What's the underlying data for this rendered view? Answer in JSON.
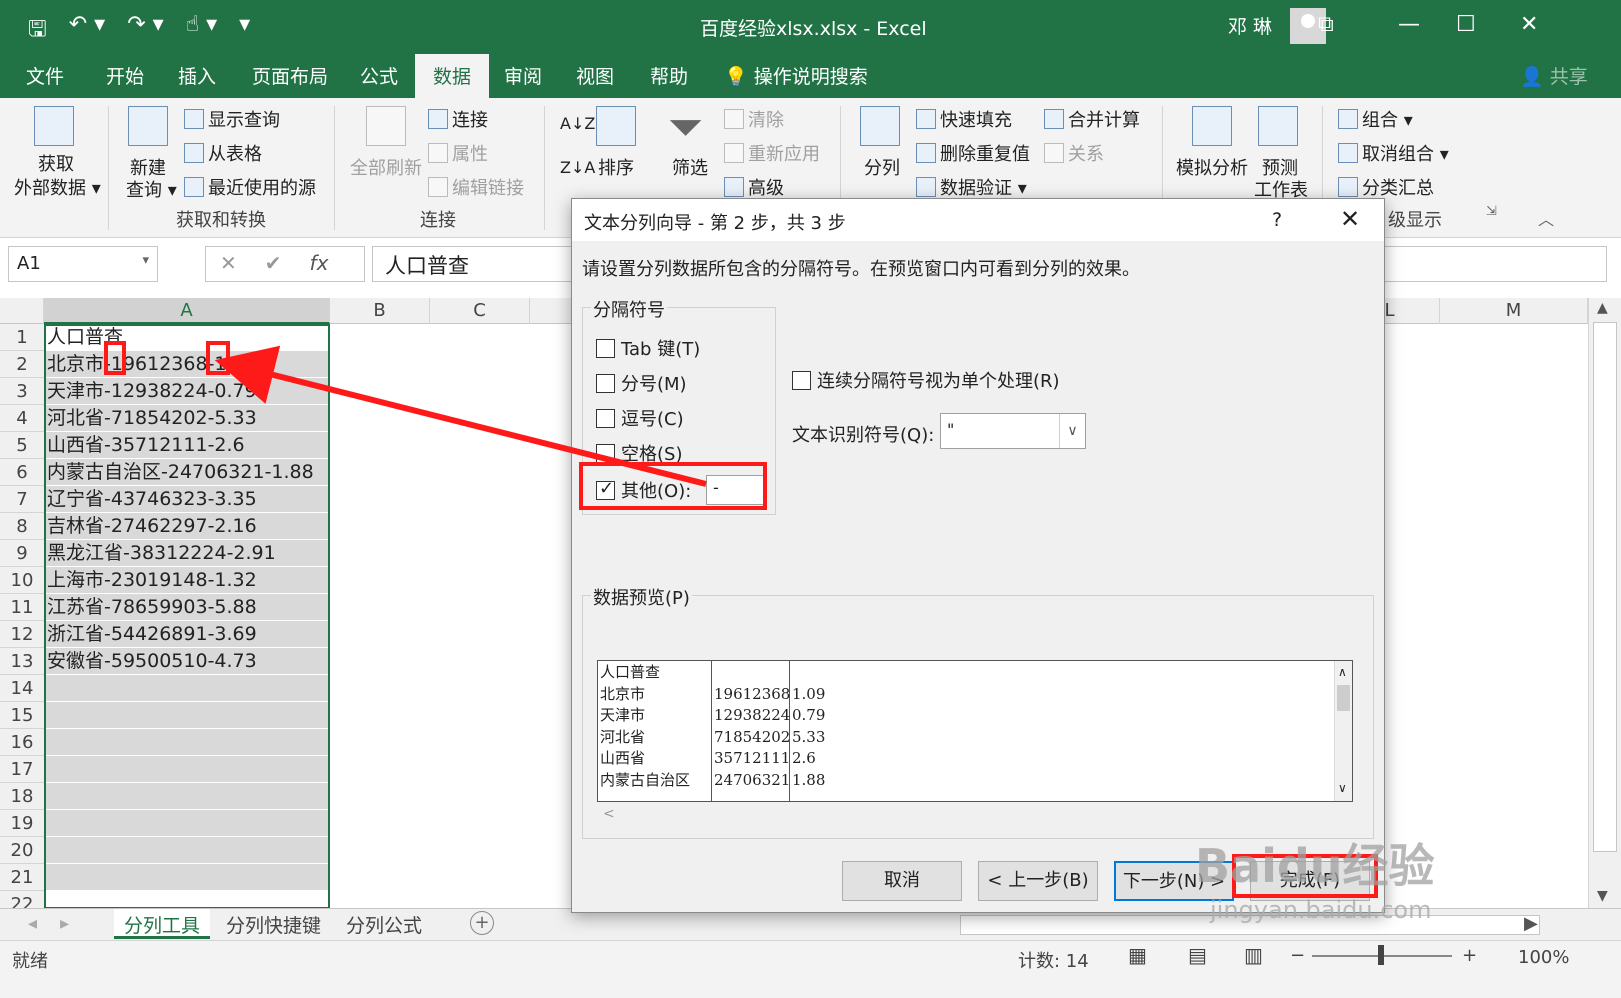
{
  "window": {
    "doc_title": "百度经验xlsx.xlsx  -  Excel",
    "user": "邓 琳",
    "share": "共享"
  },
  "tabs": [
    "文件",
    "开始",
    "插入",
    "页面布局",
    "公式",
    "数据",
    "审阅",
    "视图",
    "帮助",
    "操作说明搜索"
  ],
  "ribbon": {
    "get_data": [
      "获取",
      "外部数据 ▾"
    ],
    "new_query": [
      "新建",
      "查询 ▾"
    ],
    "show_query": "显示查询",
    "from_table": "从表格",
    "recent_sources": "最近使用的源",
    "group_get_transform": "获取和转换",
    "refresh_all": "全部刷新",
    "connections": "连接",
    "properties": "属性",
    "edit_links": "编辑链接",
    "group_connections": "连接",
    "sort": "排序",
    "filter": "筛选",
    "clear": "清除",
    "reapply": "重新应用",
    "advanced": "高级",
    "text_to_columns": "分列",
    "flash_fill": "快速填充",
    "remove_duplicates": "删除重复值",
    "data_validation": "数据验证 ▾",
    "consolidate": "合并计算",
    "relationships": "关系",
    "what_if": "模拟分析",
    "forecast": [
      "预测",
      "工作表"
    ],
    "group": "组合 ▾",
    "ungroup": "取消组合 ▾",
    "subtotal": "分类汇总",
    "group_outline": "级显示"
  },
  "formula_bar": {
    "name_box": "A1",
    "cancel": "✕",
    "enter": "✔",
    "fx": "fx",
    "content": "人口普查"
  },
  "columns": [
    "A",
    "B",
    "C",
    "L",
    "M"
  ],
  "rows": [
    "1",
    "2",
    "3",
    "4",
    "5",
    "6",
    "7",
    "8",
    "9",
    "10",
    "11",
    "12",
    "13",
    "14",
    "15",
    "16",
    "17",
    "18",
    "19",
    "20",
    "21",
    "22"
  ],
  "cells_a": [
    "人口普查",
    "北京市-19612368-1.09",
    "天津市-12938224-0.79",
    "河北省-71854202-5.33",
    "山西省-35712111-2.6",
    "内蒙古自治区-24706321-1.88",
    "辽宁省-43746323-3.35",
    "吉林省-27462297-2.16",
    "黑龙江省-38312224-2.91",
    "上海市-23019148-1.32",
    "江苏省-78659903-5.88",
    "浙江省-54426891-3.69",
    "安徽省-59500510-4.73"
  ],
  "sheets": [
    "分列工具",
    "分列快捷键",
    "分列公式"
  ],
  "status": {
    "ready": "就绪",
    "count": "计数: 14",
    "zoom": "100%"
  },
  "dialog": {
    "title": "文本分列向导 - 第 2 步，共 3 步",
    "help": "?",
    "close": "✕",
    "description": "请设置分列数据所包含的分隔符号。在预览窗口内可看到分列的效果。",
    "delimiters_title": "分隔符号",
    "tab": "Tab 键(T)",
    "semicolon": "分号(M)",
    "comma": "逗号(C)",
    "space": "空格(S)",
    "other": "其他(O):",
    "other_value": "-",
    "consecutive": "连续分隔符号视为单个处理(R)",
    "qualifier_label": "文本识别符号(Q):",
    "qualifier_value": "\"",
    "preview_title": "数据预览(P)",
    "preview_col1": [
      "人口普查",
      "北京市",
      "天津市",
      "河北省",
      "山西省",
      "内蒙古自治区"
    ],
    "preview_col2": [
      "",
      "19612368",
      "12938224",
      "71854202",
      "35712111",
      "24706321"
    ],
    "preview_col3": [
      "",
      "1.09",
      "0.79",
      "5.33",
      "2.6",
      "1.88"
    ],
    "cancel": "取消",
    "back": "< 上一步(B)",
    "next": "下一步(N) >",
    "finish": "完成(F)"
  },
  "watermark": {
    "brand": "Baidu经验",
    "url": "jingyan.baidu.com"
  },
  "colors": {
    "excel_green": "#217346",
    "annotation_red": "#ff1a1a"
  }
}
